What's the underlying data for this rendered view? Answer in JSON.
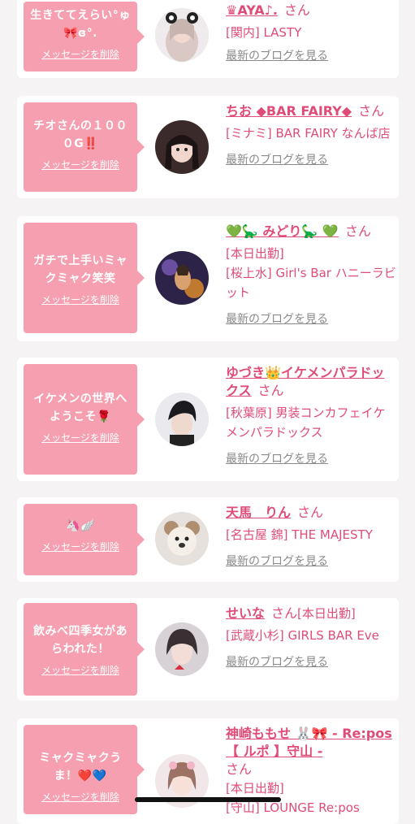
{
  "colors": {
    "accent": "#e04c78",
    "bubble": "#f59fb0",
    "link_gray": "#8a8a8a",
    "bg": "#f5f3f4"
  },
  "labels": {
    "delete_message": "メッセージを削除",
    "latest_blog": "最新のブログを見る",
    "san": "さん"
  },
  "cards": [
    {
      "message": "生きててえらい°ゅ🎀ɞ°.",
      "name": "♛AYA♪.",
      "extra": "",
      "shop_lines": [
        "[関内] LASTY"
      ],
      "avatar_icon": "avatar-photo"
    },
    {
      "message": "チオさんの１０００G‼️",
      "name": "ちお ◆BAR FAIRY◆",
      "extra": "",
      "shop_lines": [
        "[ミナミ] BAR FAIRY なんば店"
      ],
      "avatar_icon": "avatar-photo"
    },
    {
      "message": "ガチで上手いミャクミャク笑笑",
      "name": "💚🦕 みどり🦕 💚",
      "extra": "",
      "shop_lines": [
        "[本日出勤]",
        "[桜上水] Girl's Bar ハニーラビット"
      ],
      "avatar_icon": "avatar-photo"
    },
    {
      "message": "イケメンの世界へようこそ🌹",
      "name": "ゆづき👑イケメンパラドックス",
      "extra": "",
      "shop_lines": [
        "[秋葉原] 男装コンカフェイケメンパラドックス"
      ],
      "avatar_icon": "avatar-photo"
    },
    {
      "message": "🦄🪽",
      "name": "天馬　りん",
      "extra": "",
      "shop_lines": [
        "[名古屋 錦] THE MAJESTY"
      ],
      "avatar_icon": "avatar-photo"
    },
    {
      "message": "飲みべ四季女があらわれた！",
      "name": "せいな",
      "extra": "[本日出勤]",
      "shop_lines": [
        "[武蔵小杉] GIRLS BAR Eve"
      ],
      "avatar_icon": "avatar-photo"
    },
    {
      "message": "ミャクミャクうま！❤️💙",
      "name": "神崎ももせ 🐰🎀 - Re:pos 【 ルポ 】守山 -",
      "extra": "",
      "shop_lines": [
        "[本日出勤]",
        "[守山] LOUNGE Re:pos"
      ],
      "avatar_icon": "avatar-photo"
    }
  ]
}
